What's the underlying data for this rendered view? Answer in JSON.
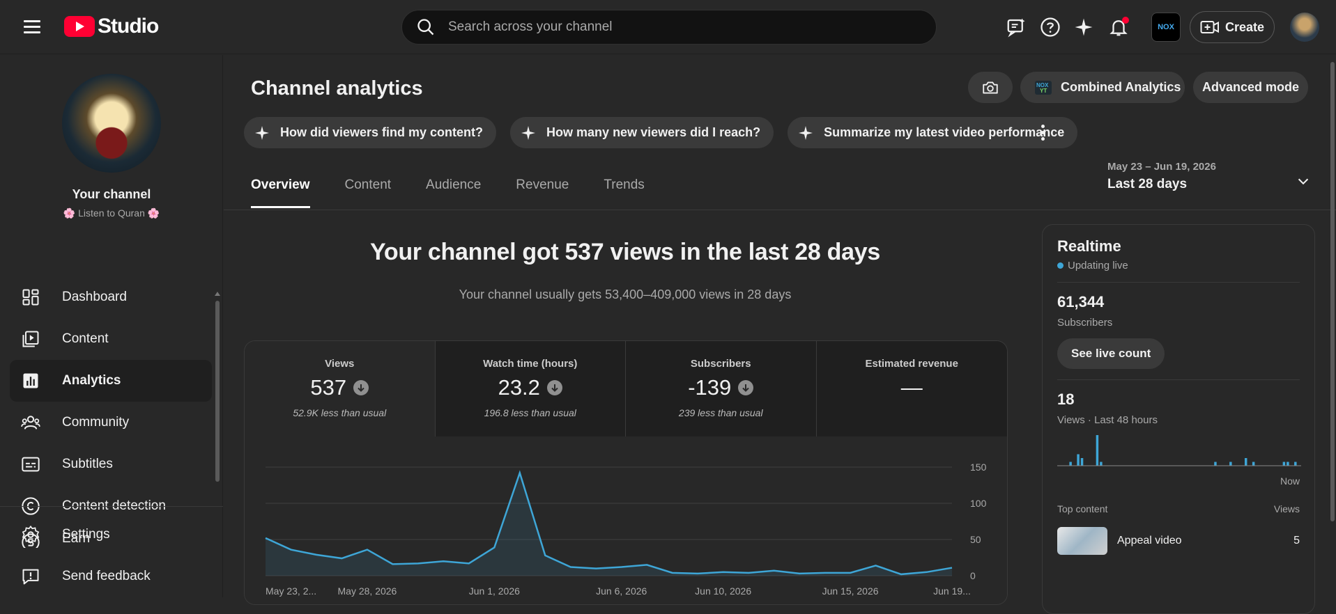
{
  "header": {
    "logo_text": "Studio",
    "search_placeholder": "Search across your channel",
    "create_label": "Create",
    "brand_badge": "NOX"
  },
  "sidebar": {
    "channel_title": "Your channel",
    "channel_name": "🌸 Listen to Quran 🌸",
    "items": [
      {
        "label": "Dashboard",
        "icon": "dashboard-icon"
      },
      {
        "label": "Content",
        "icon": "content-icon"
      },
      {
        "label": "Analytics",
        "icon": "analytics-icon",
        "active": true
      },
      {
        "label": "Community",
        "icon": "community-icon"
      },
      {
        "label": "Subtitles",
        "icon": "subtitles-icon"
      },
      {
        "label": "Content detection",
        "icon": "copyright-icon"
      },
      {
        "label": "Earn",
        "icon": "earn-icon"
      }
    ],
    "bottom_items": [
      {
        "label": "Settings",
        "icon": "gear-icon"
      },
      {
        "label": "Send feedback",
        "icon": "feedback-icon"
      }
    ]
  },
  "page": {
    "title": "Channel analytics",
    "combined_label": "Combined Analytics",
    "advanced_label": "Advanced mode",
    "chips": [
      "How did viewers find my content?",
      "How many new viewers did I reach?",
      "Summarize my latest video performance"
    ],
    "tabs": [
      "Overview",
      "Content",
      "Audience",
      "Revenue",
      "Trends"
    ],
    "active_tab": "Overview",
    "date_range_dates": "May 23 – Jun 19, 2026",
    "date_range_label": "Last 28 days"
  },
  "summary": {
    "headline": "Your channel got 537 views in the last 28 days",
    "subline": "Your channel usually gets 53,400–409,000 views in 28 days"
  },
  "metrics": [
    {
      "label": "Views",
      "value": "537",
      "note": "52.9K less than usual",
      "down": true
    },
    {
      "label": "Watch time (hours)",
      "value": "23.2",
      "note": "196.8 less than usual",
      "down": true
    },
    {
      "label": "Subscribers",
      "value": "-139",
      "note": "239 less than usual",
      "down": true
    },
    {
      "label": "Estimated revenue",
      "value": "—",
      "note": "",
      "down": false
    }
  ],
  "chart_data": {
    "type": "area",
    "series": [
      {
        "values": [
          52,
          36,
          29,
          24,
          36,
          16,
          17,
          20,
          17,
          39,
          142,
          28,
          12,
          10,
          12,
          15,
          4,
          3,
          5,
          4,
          7,
          3,
          4,
          4,
          14,
          2,
          5,
          11
        ]
      }
    ],
    "y_ticks": [
      "150",
      "100",
      "50",
      "0"
    ],
    "ylim": [
      0,
      150
    ],
    "x_tick_labels": [
      "May 23, 2...",
      "May 28, 2026",
      "Jun 1, 2026",
      "Jun 6, 2026",
      "Jun 10, 2026",
      "Jun 15, 2026",
      "Jun 19..."
    ],
    "grid": true,
    "color": "#3ea6d7"
  },
  "realtime": {
    "title": "Realtime",
    "status": "Updating live",
    "subscribers_value": "61,344",
    "subscribers_label": "Subscribers",
    "live_count_label": "See live count",
    "views_value": "18",
    "views_label": "Views · Last 48 hours",
    "now_label": "Now",
    "bars": [
      0,
      0,
      0,
      1,
      0,
      3,
      2,
      0,
      0,
      0,
      8,
      1,
      0,
      0,
      0,
      0,
      0,
      0,
      0,
      0,
      0,
      0,
      0,
      0,
      0,
      0,
      0,
      0,
      0,
      0,
      0,
      0,
      0,
      0,
      0,
      0,
      0,
      0,
      0,
      0,
      0,
      1,
      0,
      0,
      0,
      1,
      0,
      0,
      0,
      2,
      0,
      1,
      0,
      0,
      0,
      0,
      0,
      0,
      0,
      1,
      1,
      0,
      1,
      0
    ],
    "top_content_label": "Top content",
    "views_col_label": "Views",
    "top_items": [
      {
        "title": "Appeal video",
        "views": "5"
      }
    ]
  }
}
